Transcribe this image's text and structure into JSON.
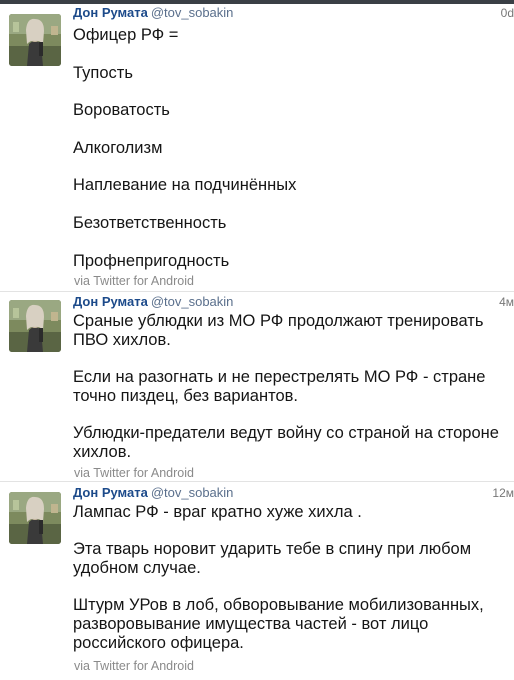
{
  "tweets": [
    {
      "author_name": "Дон Румата",
      "author_handle": "@tov_sobakin",
      "time": "0d",
      "paragraphs": [
        "Офицер РФ =",
        "Тупость",
        "Вороватость",
        "Алкоголизм",
        "Наплевание на подчинённых",
        "Безответственность",
        "Профнепригодность"
      ],
      "via": "via Twitter for Android"
    },
    {
      "author_name": "Дон Румата",
      "author_handle": "@tov_sobakin",
      "time": "4м",
      "paragraphs": [
        "Сраные ублюдки из МО РФ продолжают тренировать ПВО хихлов.",
        "Если на разогнать и не перестрелять МО РФ - стране точно пиздец, без вариантов.",
        "Ублюдки-предатели ведут войну со страной на стороне хихлов."
      ],
      "via": "via Twitter for Android"
    },
    {
      "author_name": "Дон Румата",
      "author_handle": "@tov_sobakin",
      "time": "12м",
      "paragraphs": [
        "Лампас РФ - враг кратно хуже хихла .",
        "Эта тварь норовит ударить  тебе в спину при любом удобном случае.",
        "Штурм УРов в лоб, обворовывание мобилизованных, разворовывание имущества частей - вот лицо российского офицера."
      ],
      "via": "via Twitter for Android"
    }
  ],
  "colors": {
    "name": "#1c4a8a",
    "handle": "#5a6f8c",
    "meta": "#8a8a8a",
    "divider": "#e3e3e3"
  },
  "icons": {
    "avatar": "user-avatar-photo"
  }
}
